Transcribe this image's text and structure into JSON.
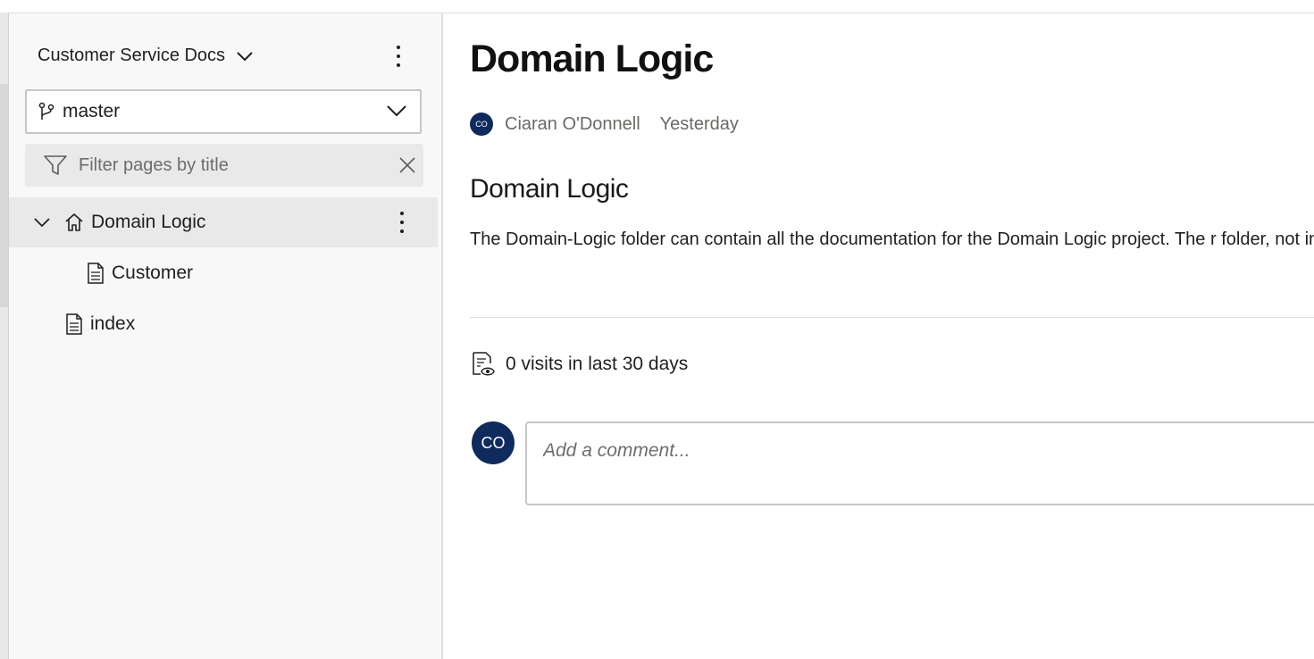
{
  "sidebar": {
    "project_name": "Customer Service Docs",
    "branch": "master",
    "filter_placeholder": "Filter pages by title",
    "tree": [
      {
        "label": "Domain Logic",
        "icon": "home-icon",
        "expanded": true,
        "selected": true
      },
      {
        "label": "Customer",
        "icon": "page-icon",
        "selected": false
      },
      {
        "label": "index",
        "icon": "page-icon",
        "selected": false
      }
    ]
  },
  "page": {
    "title": "Domain Logic",
    "author_initials": "CO",
    "author": "Ciaran O'Donnell",
    "date": "Yesterday",
    "heading": "Domain Logic",
    "paragraph": "The Domain-Logic folder can contain all the documentation for the Domain Logic project. The r folder, not inside it.",
    "visits": "0 visits in last 30 days",
    "comment_placeholder": "Add a comment..."
  },
  "colors": {
    "avatar": "#0f2a5c",
    "sidebar_bg": "#f8f8f8",
    "selected_row": "#e9e9e9"
  }
}
